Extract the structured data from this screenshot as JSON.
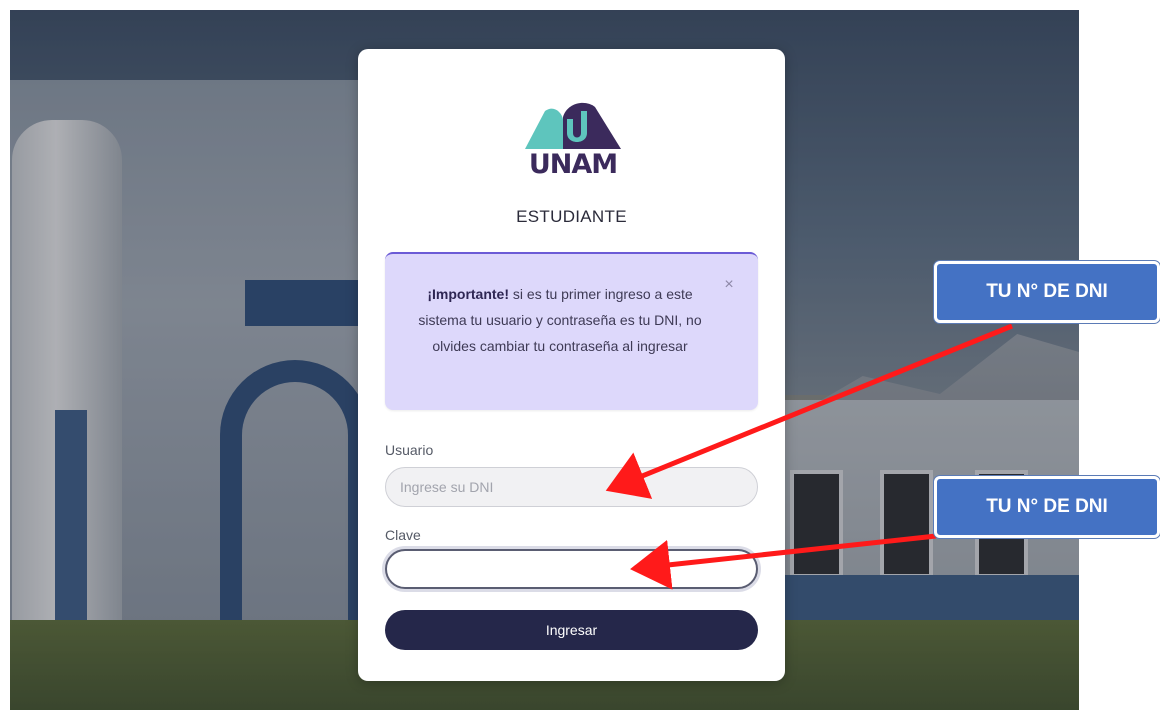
{
  "login": {
    "brand": "UNAM",
    "role_title": "ESTUDIANTE",
    "alert": {
      "bold": "¡Importante!",
      "message": " si es tu primer ingreso a este sistema tu usuario y contraseña es tu DNI, no olvides cambiar tu contraseña al ingresar",
      "close_symbol": "×"
    },
    "username": {
      "label": "Usuario",
      "placeholder": "Ingrese su DNI",
      "value": ""
    },
    "password": {
      "label": "Clave",
      "value": ""
    },
    "submit_label": "Ingresar"
  },
  "annotations": [
    {
      "text": "TU N° DE DNI"
    },
    {
      "text": "TU N° DE DNI"
    }
  ],
  "colors": {
    "logo_teal": "#5ec5bd",
    "logo_purple": "#3b2a5c",
    "alert_bg": "#ddd8fb",
    "button_bg": "#25274a",
    "callout_bg": "#4472c4",
    "arrow": "#ff1a1a"
  },
  "icons": {
    "alert_close": "close-icon",
    "logo": "unam-logo"
  }
}
